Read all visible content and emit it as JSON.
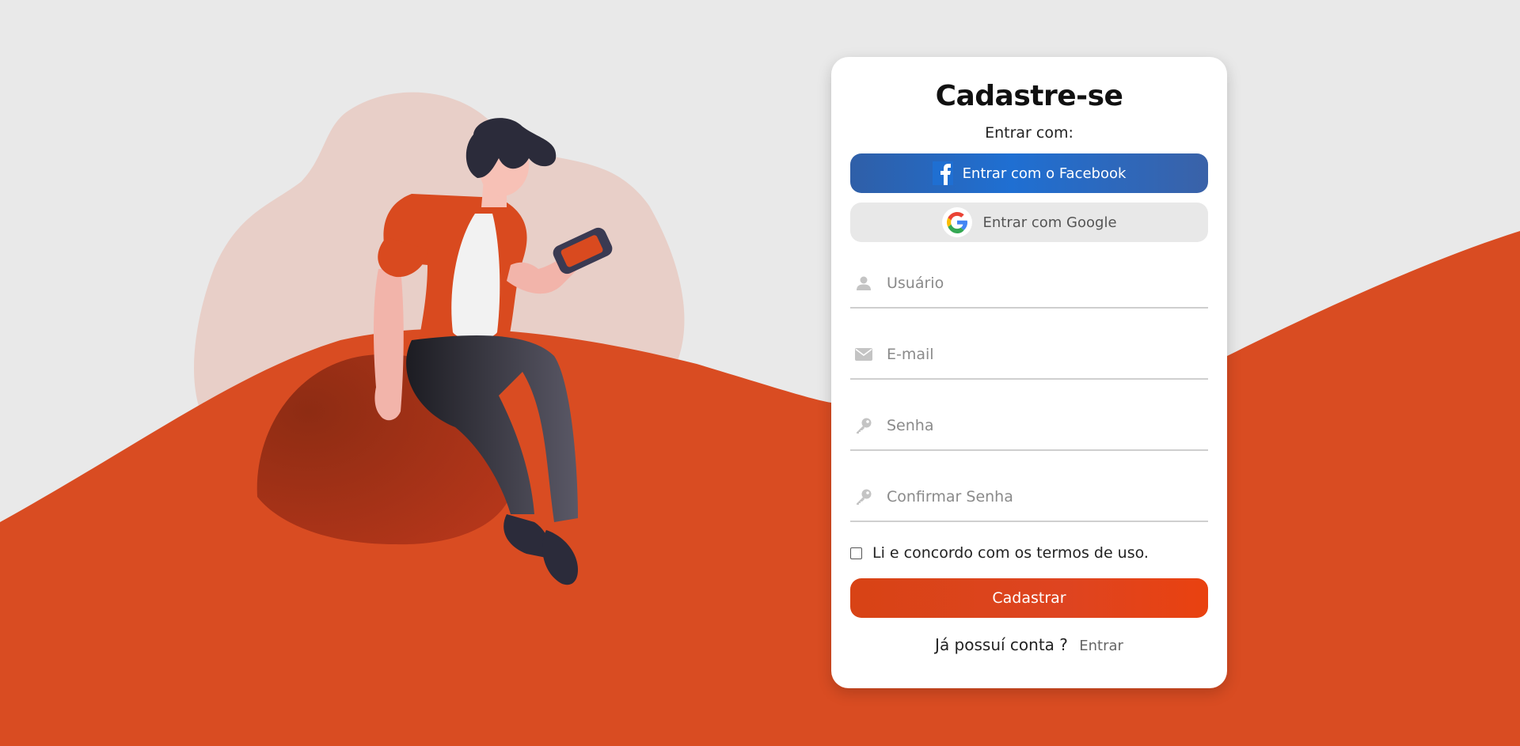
{
  "form": {
    "title": "Cadastre-se",
    "subtitle": "Entrar com:",
    "facebook_label": "Entrar com o Facebook",
    "google_label": "Entrar com Google",
    "fields": {
      "username_placeholder": "Usuário",
      "email_placeholder": "E-mail",
      "password_placeholder": "Senha",
      "confirm_password_placeholder": "Confirmar Senha"
    },
    "terms_label": "Li e concordo com os termos de uso.",
    "submit_label": "Cadastrar",
    "footer_question": "Já possuí conta ?",
    "footer_link": "Entrar"
  },
  "icons": {
    "facebook": "facebook-icon",
    "google": "google-icon",
    "user": "user-icon",
    "email": "envelope-icon",
    "password": "key-icon",
    "confirm_password": "key-icon"
  },
  "colors": {
    "accent": "#db4a20",
    "background": "#e9e9e9",
    "facebook": "#1f6fd2",
    "google_button": "#e8e8e8",
    "illustration_blob": "#e8cfc8"
  }
}
